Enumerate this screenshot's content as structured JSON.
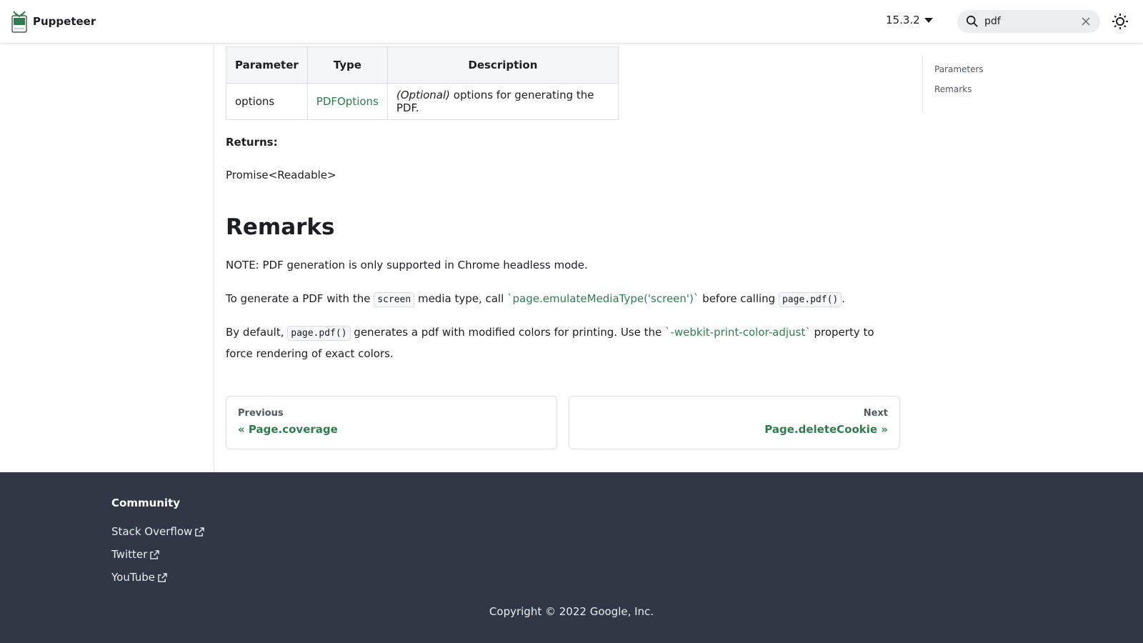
{
  "navbar": {
    "title": "Puppeteer",
    "version": "15.3.2",
    "search_value": "pdf"
  },
  "params_table": {
    "headers": [
      "Parameter",
      "Type",
      "Description"
    ],
    "row": {
      "parameter": "options",
      "type": "PDFOptions",
      "desc_optional": "(Optional)",
      "desc_rest": " options for generating the PDF."
    }
  },
  "returns": {
    "label": "Returns:",
    "value": "Promise<Readable>"
  },
  "remarks": {
    "heading": "Remarks",
    "note": "NOTE: PDF generation is only supported in Chrome headless mode.",
    "p2_a": "To generate a PDF with the ",
    "p2_code1": "screen",
    "p2_b": " media type, call ",
    "p2_link": "`page.emulateMediaType('screen')`",
    "p2_c": " before calling ",
    "p2_code2": "page.pdf()",
    "p2_d": ".",
    "p3_a": "By default, ",
    "p3_code": "page.pdf()",
    "p3_b": " generates a pdf with modified colors for printing. Use the ",
    "p3_link": "`-webkit-print-color-adjust`",
    "p3_c": " property to force rendering of exact colors."
  },
  "pager": {
    "prev_sub": "Previous",
    "prev_label": "« Page.coverage",
    "next_sub": "Next",
    "next_label": "Page.deleteCookie »"
  },
  "toc": {
    "items": [
      "Parameters",
      "Remarks"
    ]
  },
  "footer": {
    "title": "Community",
    "links": [
      "Stack Overflow",
      "Twitter",
      "YouTube"
    ],
    "copyright": "Copyright © 2022 Google, Inc."
  },
  "colors": {
    "link": "#2e7d4f",
    "footer_bg": "#303846"
  }
}
